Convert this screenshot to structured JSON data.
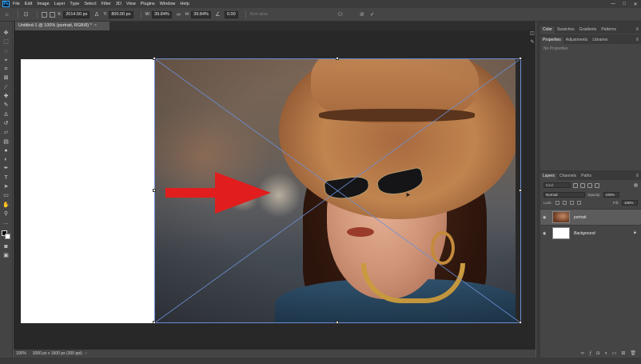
{
  "app": {
    "logo": "Ps"
  },
  "menu": [
    "File",
    "Edit",
    "Image",
    "Layer",
    "Type",
    "Select",
    "Filter",
    "3D",
    "View",
    "Plugins",
    "Window",
    "Help"
  ],
  "window_controls": [
    "—",
    "□",
    "✕"
  ],
  "options": {
    "x_label": "X:",
    "x_value": "2014.50 px",
    "y_label": "Y:",
    "y_value": "800.00 px",
    "w_label": "W:",
    "w_value": "39.84%",
    "h_label": "H:",
    "h_value": "39.84%",
    "angle_value": "0.00",
    "antialias_label": "Anti-alias"
  },
  "document": {
    "tab_title": "Untitled-1 @ 100% (portrait, RGB/8) *",
    "close": "×"
  },
  "status": {
    "zoom": "100%",
    "info": "3000 px x 1600 px (300 ppi)"
  },
  "panels": {
    "color_tabs": [
      "Color",
      "Swatches",
      "Gradients",
      "Patterns"
    ],
    "properties_tabs": [
      "Properties",
      "Adjustments",
      "Libraries"
    ],
    "properties_empty": "No Properties",
    "layers_tabs": [
      "Layers",
      "Channels",
      "Paths"
    ],
    "kind_placeholder": "Kind",
    "blend_mode": "Normal",
    "opacity_label": "Opacity:",
    "opacity_value": "100%",
    "lock_label": "Lock:",
    "fill_label": "Fill:",
    "fill_value": "100%",
    "layers": [
      {
        "name": "portrait",
        "selected": true
      },
      {
        "name": "Background",
        "selected": false
      }
    ]
  },
  "colors": {
    "arrow": "#e11d1d",
    "transform_lines": "#6d8fd6"
  }
}
